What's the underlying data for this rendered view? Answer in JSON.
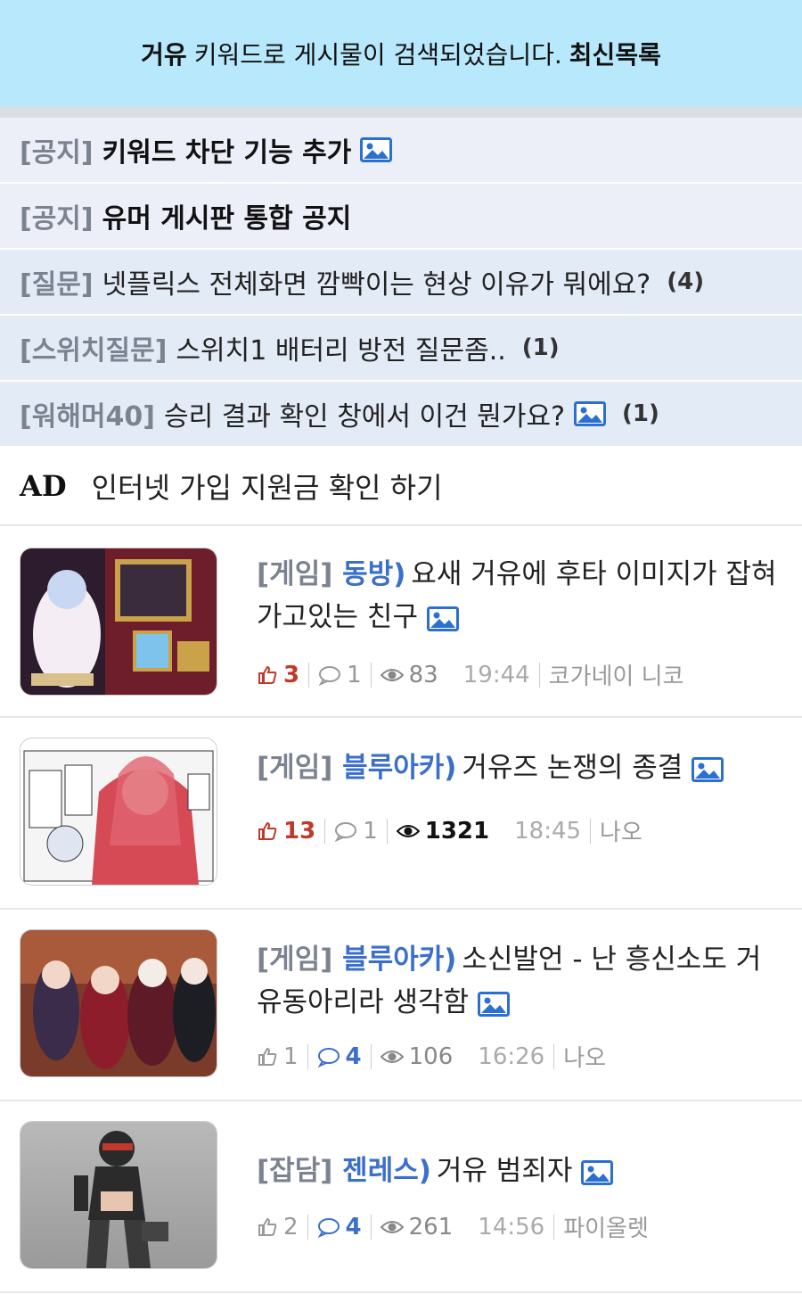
{
  "banner": {
    "keyword": "거유",
    "message": "키워드로 게시물이 검색되었습니다.",
    "link": "최신목록"
  },
  "notices": [
    {
      "tag": "[공지]",
      "title": "키워드 차단 기능 추가",
      "bold": true,
      "image": true,
      "count": ""
    },
    {
      "tag": "[공지]",
      "title": "유머 게시판 통합 공지",
      "bold": true,
      "image": false,
      "count": ""
    },
    {
      "tag": "[질문]",
      "title": "넷플릭스 전체화면 깜빡이는 현상 이유가 뭐에요?",
      "bold": false,
      "image": false,
      "count": "(4)"
    },
    {
      "tag": "[스위치질문]",
      "title": "스위치1 배터리 방전 질문좀..",
      "bold": false,
      "image": false,
      "count": "(1)"
    },
    {
      "tag": "[워해머40]",
      "title": "승리 결과 확인 창에서 이건 뭔가요?",
      "bold": false,
      "image": true,
      "count": "(1)"
    }
  ],
  "ad": {
    "label": "AD",
    "text": "인터넷 가입 지원금 확인 하기"
  },
  "posts": [
    {
      "tag": "[게임]",
      "category": "동방)",
      "title": "요새 거유에 후타 이미지가 잡혀가고있는 친구",
      "likes": "3",
      "comments": "1",
      "views": "83",
      "time": "19:44",
      "author": "코가네이 니코",
      "likes_hot": true,
      "comments_hot": false,
      "views_hot": false,
      "thumb": "touhou-game-screenshot"
    },
    {
      "tag": "[게임]",
      "category": "블루아카)",
      "title": "거유즈 논쟁의 종결",
      "likes": "13",
      "comments": "1",
      "views": "1321",
      "time": "18:45",
      "author": "나오",
      "likes_hot": true,
      "comments_hot": false,
      "views_hot": true,
      "thumb": "manga-panel"
    },
    {
      "tag": "[게임]",
      "category": "블루아카)",
      "title": "소신발언 - 난 흥신소도 거유동아리라 생각함",
      "likes": "1",
      "comments": "4",
      "views": "106",
      "time": "16:26",
      "author": "나오",
      "likes_hot": false,
      "comments_hot": true,
      "views_hot": false,
      "thumb": "group-illustration"
    },
    {
      "tag": "[잡담]",
      "category": "젠레스)",
      "title": "거유 범죄자",
      "likes": "2",
      "comments": "4",
      "views": "261",
      "time": "14:56",
      "author": "파이올렛",
      "likes_hot": false,
      "comments_hot": true,
      "views_hot": false,
      "thumb": "character-render"
    }
  ]
}
